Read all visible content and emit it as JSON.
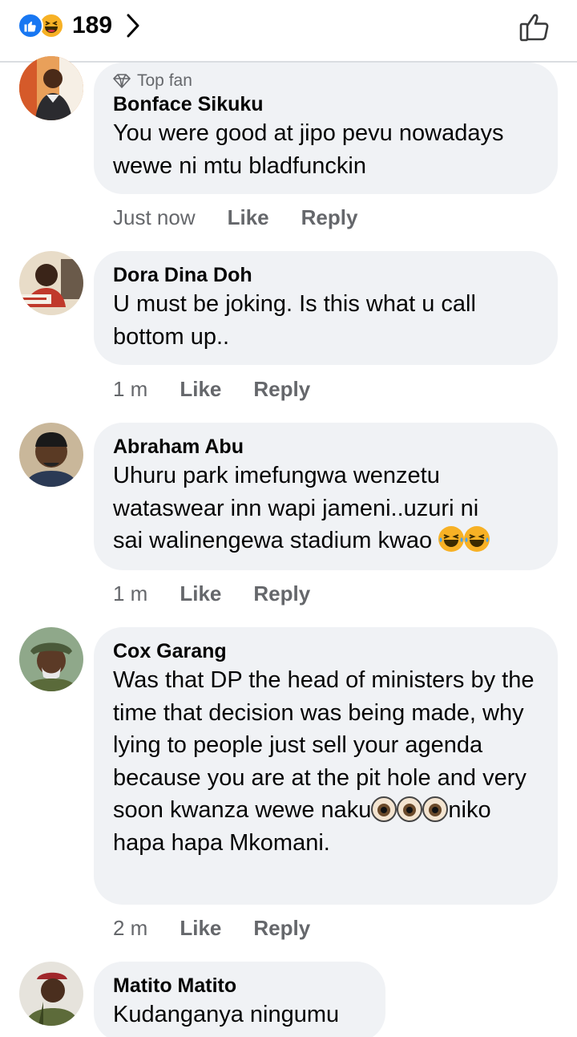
{
  "header": {
    "reaction_count": "189"
  },
  "comments": [
    {
      "badge": "Top fan",
      "author": "Bonface Sikuku",
      "text": "You were good at jipo pevu nowadays wewe ni mtu bladfunckin",
      "time": "Just now",
      "like": "Like",
      "reply": "Reply"
    },
    {
      "author": "Dora Dina Doh",
      "text": "U must be joking.  Is this what u call bottom up..",
      "time": "1 m",
      "like": "Like",
      "reply": "Reply"
    },
    {
      "author": "Abraham Abu",
      "text_line1": "Uhuru park imefungwa wenzetu",
      "text_line2": "wataswear inn wapi jameni..uzuri ni",
      "text_line3": "sai walinengewa stadium kwao",
      "time": "1 m",
      "like": "Like",
      "reply": "Reply"
    },
    {
      "author": "Cox Garang",
      "text_part1": "Was that DP the head of ministers by the time that decision was being made, why lying to people just sell your agenda because you are at the pit hole and very soon kwanza wewe naku",
      "text_part2": "niko hapa hapa Mkomani.",
      "time": "2 m",
      "like": "Like",
      "reply": "Reply"
    },
    {
      "author": "Matito Matito",
      "text": "Kudanganya ningumu"
    }
  ],
  "colors": {
    "bubble": "#f0f2f5",
    "meta": "#65676b",
    "like_blue": "#1877f2",
    "haha_yellow": "#f7b125"
  },
  "icons": [
    "like-reaction-icon",
    "haha-reaction-icon",
    "chevron-right-icon",
    "thumbs-up-icon",
    "diamond-icon",
    "laughing-emoji",
    "eyes-emoji"
  ]
}
